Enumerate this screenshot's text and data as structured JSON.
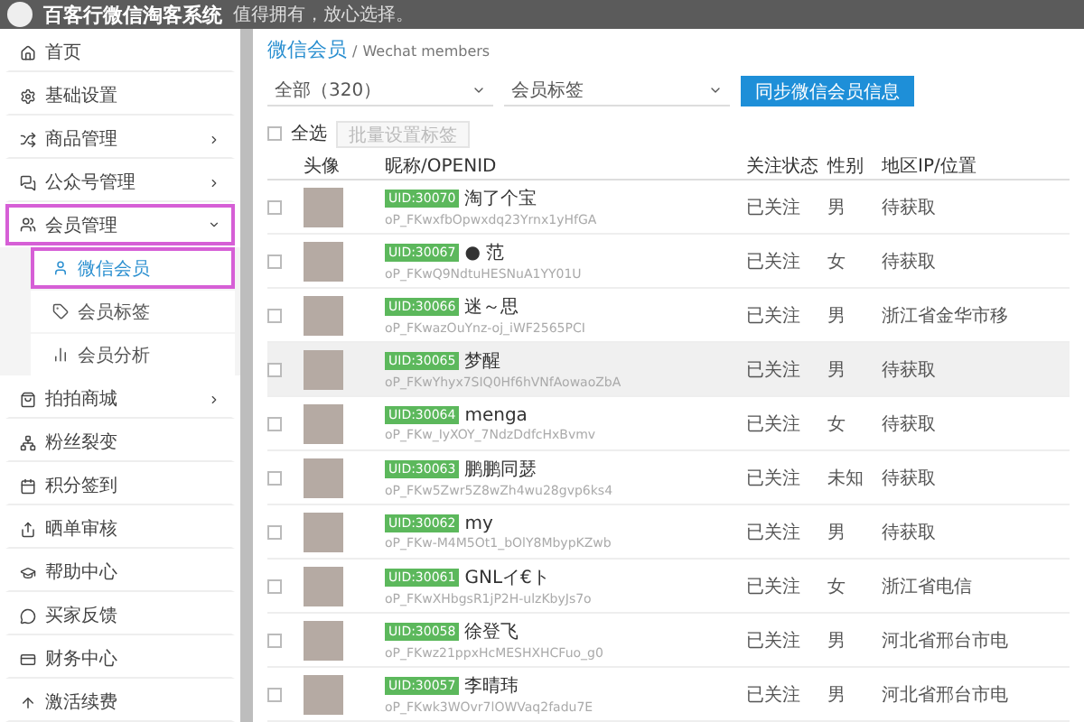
{
  "header": {
    "title": "百客行微信淘客系统",
    "slogan": "值得拥有，放心选择。"
  },
  "sidebar": {
    "items": [
      {
        "label": "首页",
        "has_arrow": false,
        "selected": false
      },
      {
        "label": "基础设置",
        "has_arrow": false,
        "selected": false
      },
      {
        "label": "商品管理",
        "has_arrow": true,
        "selected": false
      },
      {
        "label": "公众号管理",
        "has_arrow": true,
        "selected": false
      },
      {
        "label": "会员管理",
        "has_arrow": true,
        "selected": true,
        "expanded": true,
        "children": [
          {
            "label": "微信会员",
            "selected": true
          },
          {
            "label": "会员标签",
            "selected": false
          },
          {
            "label": "会员分析",
            "selected": false
          }
        ]
      },
      {
        "label": "拍拍商城",
        "has_arrow": true,
        "selected": false
      },
      {
        "label": "粉丝裂变",
        "has_arrow": false,
        "selected": false
      },
      {
        "label": "积分签到",
        "has_arrow": false,
        "selected": false
      },
      {
        "label": "晒单审核",
        "has_arrow": false,
        "selected": false
      },
      {
        "label": "帮助中心",
        "has_arrow": false,
        "selected": false
      },
      {
        "label": "买家反馈",
        "has_arrow": false,
        "selected": false
      },
      {
        "label": "财务中心",
        "has_arrow": false,
        "selected": false
      },
      {
        "label": "激活续费",
        "has_arrow": false,
        "selected": false
      }
    ]
  },
  "breadcrumb": {
    "title": "微信会员",
    "separator": "/",
    "subtitle": "Wechat members"
  },
  "filters": {
    "group": "全部（320）",
    "tag": "会员标签",
    "sync_button": "同步微信会员信息"
  },
  "bulk": {
    "select_all": "全选",
    "select_all_checked": false,
    "set_tag_button": "批量设置标签",
    "set_tag_disabled": true
  },
  "table": {
    "columns": [
      "头像",
      "昵称/OPENID",
      "关注状态",
      "性别",
      "地区IP/位置"
    ],
    "rows": [
      {
        "uid": "UID:30070",
        "nickname": "淘了个宝",
        "openid": "oP_FKwxfbOpwxdq23Yrnx1yHfGA",
        "status": "已关注",
        "gender": "男",
        "region": "待获取",
        "checked": false,
        "selected": false
      },
      {
        "uid": "UID:30067",
        "nickname": "● 范",
        "openid": "oP_FKwQ9NdtuHESNuA1YY01U",
        "status": "已关注",
        "gender": "女",
        "region": "待获取",
        "checked": false,
        "selected": false
      },
      {
        "uid": "UID:30066",
        "nickname": "迷～思",
        "openid": "oP_FKwazOuYnz-oj_iWF2565PCI",
        "status": "已关注",
        "gender": "男",
        "region": "浙江省金华市移",
        "checked": false,
        "selected": false
      },
      {
        "uid": "UID:30065",
        "nickname": "梦醒",
        "openid": "oP_FKwYhyx7SIQ0Hf6hVNfAowaoZbA",
        "status": "已关注",
        "gender": "男",
        "region": "待获取",
        "checked": false,
        "selected": true
      },
      {
        "uid": "UID:30064",
        "nickname": "menga",
        "openid": "oP_FKw_IyXOY_7NdzDdfcHxBvmv",
        "status": "已关注",
        "gender": "女",
        "region": "待获取",
        "checked": false,
        "selected": false
      },
      {
        "uid": "UID:30063",
        "nickname": "鹏鹏同瑟",
        "openid": "oP_FKw5Zwr5Z8wZh4wu28gvp6ks4",
        "status": "已关注",
        "gender": "未知",
        "region": "待获取",
        "checked": false,
        "selected": false
      },
      {
        "uid": "UID:30062",
        "nickname": "my",
        "openid": "oP_FKw-M4M5Ot1_bOlY8MbypKZwb",
        "status": "已关注",
        "gender": "男",
        "region": "待获取",
        "checked": false,
        "selected": false
      },
      {
        "uid": "UID:30061",
        "nickname": "GNLイ€ト",
        "openid": "oP_FKwXHbgsR1jP2H-ulzKbyJs7o",
        "status": "已关注",
        "gender": "女",
        "region": "浙江省电信",
        "checked": false,
        "selected": false
      },
      {
        "uid": "UID:30058",
        "nickname": "徐登飞",
        "openid": "oP_FKwz21ppxHcMESHXHCFuo_g0",
        "status": "已关注",
        "gender": "男",
        "region": "河北省邢台市电",
        "checked": false,
        "selected": false
      },
      {
        "uid": "UID:30057",
        "nickname": "李晴玮",
        "openid": "oP_FKwk3WOvr7lOWVaq2fadu7E",
        "status": "已关注",
        "gender": "男",
        "region": "河北省邢台市电",
        "checked": false,
        "selected": false
      }
    ]
  }
}
